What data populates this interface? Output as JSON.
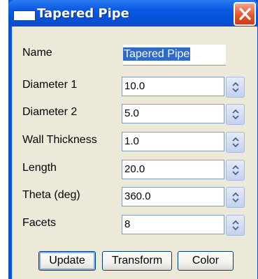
{
  "window": {
    "title": "Tapered Pipe"
  },
  "fields": [
    {
      "label": "Name",
      "value": "Tapered Pipe",
      "selected": true
    },
    {
      "label": "Diameter 1",
      "value": "10.0"
    },
    {
      "label": "Diameter 2",
      "value": "5.0"
    },
    {
      "label": "Wall Thickness",
      "value": "1.0"
    },
    {
      "label": "Length",
      "value": "20.0"
    },
    {
      "label": "Theta (deg)",
      "value": "360.0"
    },
    {
      "label": "Facets",
      "value": "8"
    }
  ],
  "buttons": {
    "update": "Update",
    "transform": "Transform",
    "color": "Color"
  },
  "colors": {
    "titlebar": "#0c5ae6",
    "client_bg": "#ece9d8",
    "close_button": "#e2572e",
    "selection": "#316ac5"
  }
}
